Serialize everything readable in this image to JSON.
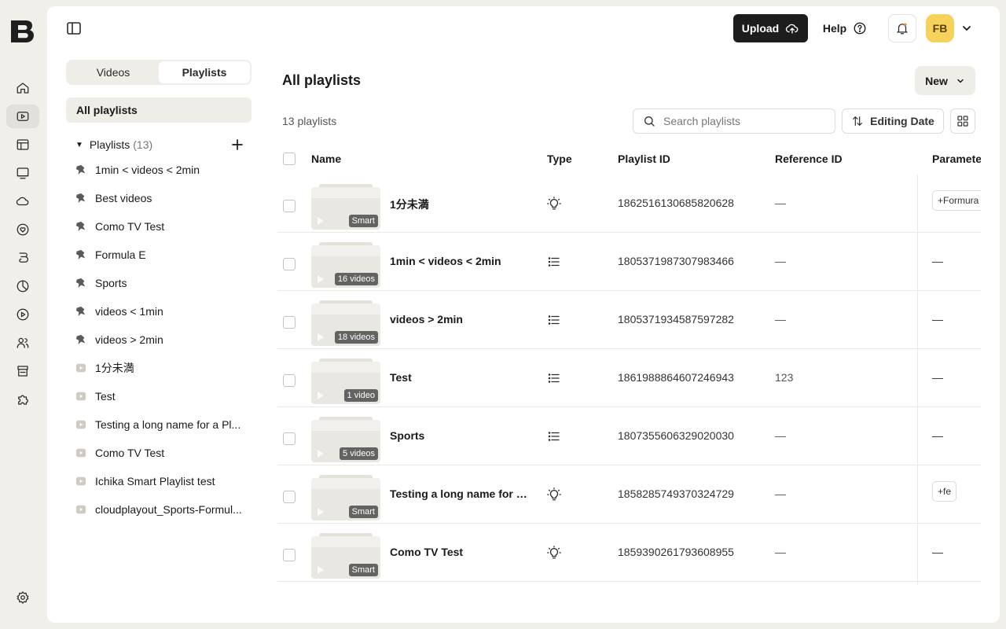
{
  "header": {
    "upload_label": "Upload",
    "help_label": "Help",
    "avatar_initials": "FB"
  },
  "sidebar": {
    "tabs": [
      {
        "label": "Videos",
        "active": false
      },
      {
        "label": "Playlists",
        "active": true
      }
    ],
    "all_playlists_label": "All playlists",
    "playlists_header": {
      "label": "Playlists",
      "count": "(13)"
    },
    "items": [
      {
        "label": "1min < videos < 2min",
        "icon": "smart-playlist-icon"
      },
      {
        "label": "Best videos",
        "icon": "smart-playlist-icon"
      },
      {
        "label": "Como TV Test",
        "icon": "smart-playlist-icon"
      },
      {
        "label": "Formula E",
        "icon": "smart-playlist-icon"
      },
      {
        "label": "Sports",
        "icon": "smart-playlist-icon"
      },
      {
        "label": "videos < 1min",
        "icon": "smart-playlist-icon"
      },
      {
        "label": "videos > 2min",
        "icon": "smart-playlist-icon"
      },
      {
        "label": "1分未満",
        "icon": "video-playlist-icon"
      },
      {
        "label": "Test",
        "icon": "video-playlist-icon"
      },
      {
        "label": "Testing a long name for a Pl...",
        "icon": "video-playlist-icon"
      },
      {
        "label": "Como TV Test",
        "icon": "video-playlist-icon"
      },
      {
        "label": "Ichika Smart Playlist test",
        "icon": "video-playlist-icon"
      },
      {
        "label": "cloudplayout_Sports-Formul...",
        "icon": "video-playlist-icon"
      }
    ]
  },
  "main": {
    "title": "All playlists",
    "new_label": "New",
    "count_label": "13 playlists",
    "search_placeholder": "Search playlists",
    "sort_label": "Editing Date",
    "columns": [
      "Name",
      "Type",
      "Playlist ID",
      "Reference ID",
      "Paramete"
    ],
    "rows": [
      {
        "name": "1分未満",
        "badge": "Smart",
        "type": "lightbulb-icon",
        "playlist_id": "1862516130685820628",
        "reference_id": "—",
        "param": "+Formura",
        "param_chip": true
      },
      {
        "name": "1min < videos < 2min",
        "badge": "16 videos",
        "type": "list-icon",
        "playlist_id": "1805371987307983466",
        "reference_id": "—",
        "param": "—",
        "param_chip": false
      },
      {
        "name": "videos > 2min",
        "badge": "18 videos",
        "type": "list-icon",
        "playlist_id": "1805371934587597282",
        "reference_id": "—",
        "param": "—",
        "param_chip": false
      },
      {
        "name": "Test",
        "badge": "1 video",
        "type": "list-icon",
        "playlist_id": "1861988864607246943",
        "reference_id": "123",
        "param": "—",
        "param_chip": false
      },
      {
        "name": "Sports",
        "badge": "5 videos",
        "type": "list-icon",
        "playlist_id": "1807355606329020030",
        "reference_id": "—",
        "param": "—",
        "param_chip": false
      },
      {
        "name": "Testing a long name for a...",
        "badge": "Smart",
        "type": "lightbulb-icon",
        "playlist_id": "1858285749370324729",
        "reference_id": "—",
        "param": "+fe",
        "param_chip": true
      },
      {
        "name": "Como TV Test",
        "badge": "Smart",
        "type": "lightbulb-icon",
        "playlist_id": "1859390261793608955",
        "reference_id": "—",
        "param": "—",
        "param_chip": false
      }
    ]
  },
  "colors": {
    "background": "#f1efea",
    "panel": "#ffffff",
    "primary_button": "#1d1d1d",
    "avatar": "#f6d25c",
    "notification_dot": "#e8853b"
  }
}
